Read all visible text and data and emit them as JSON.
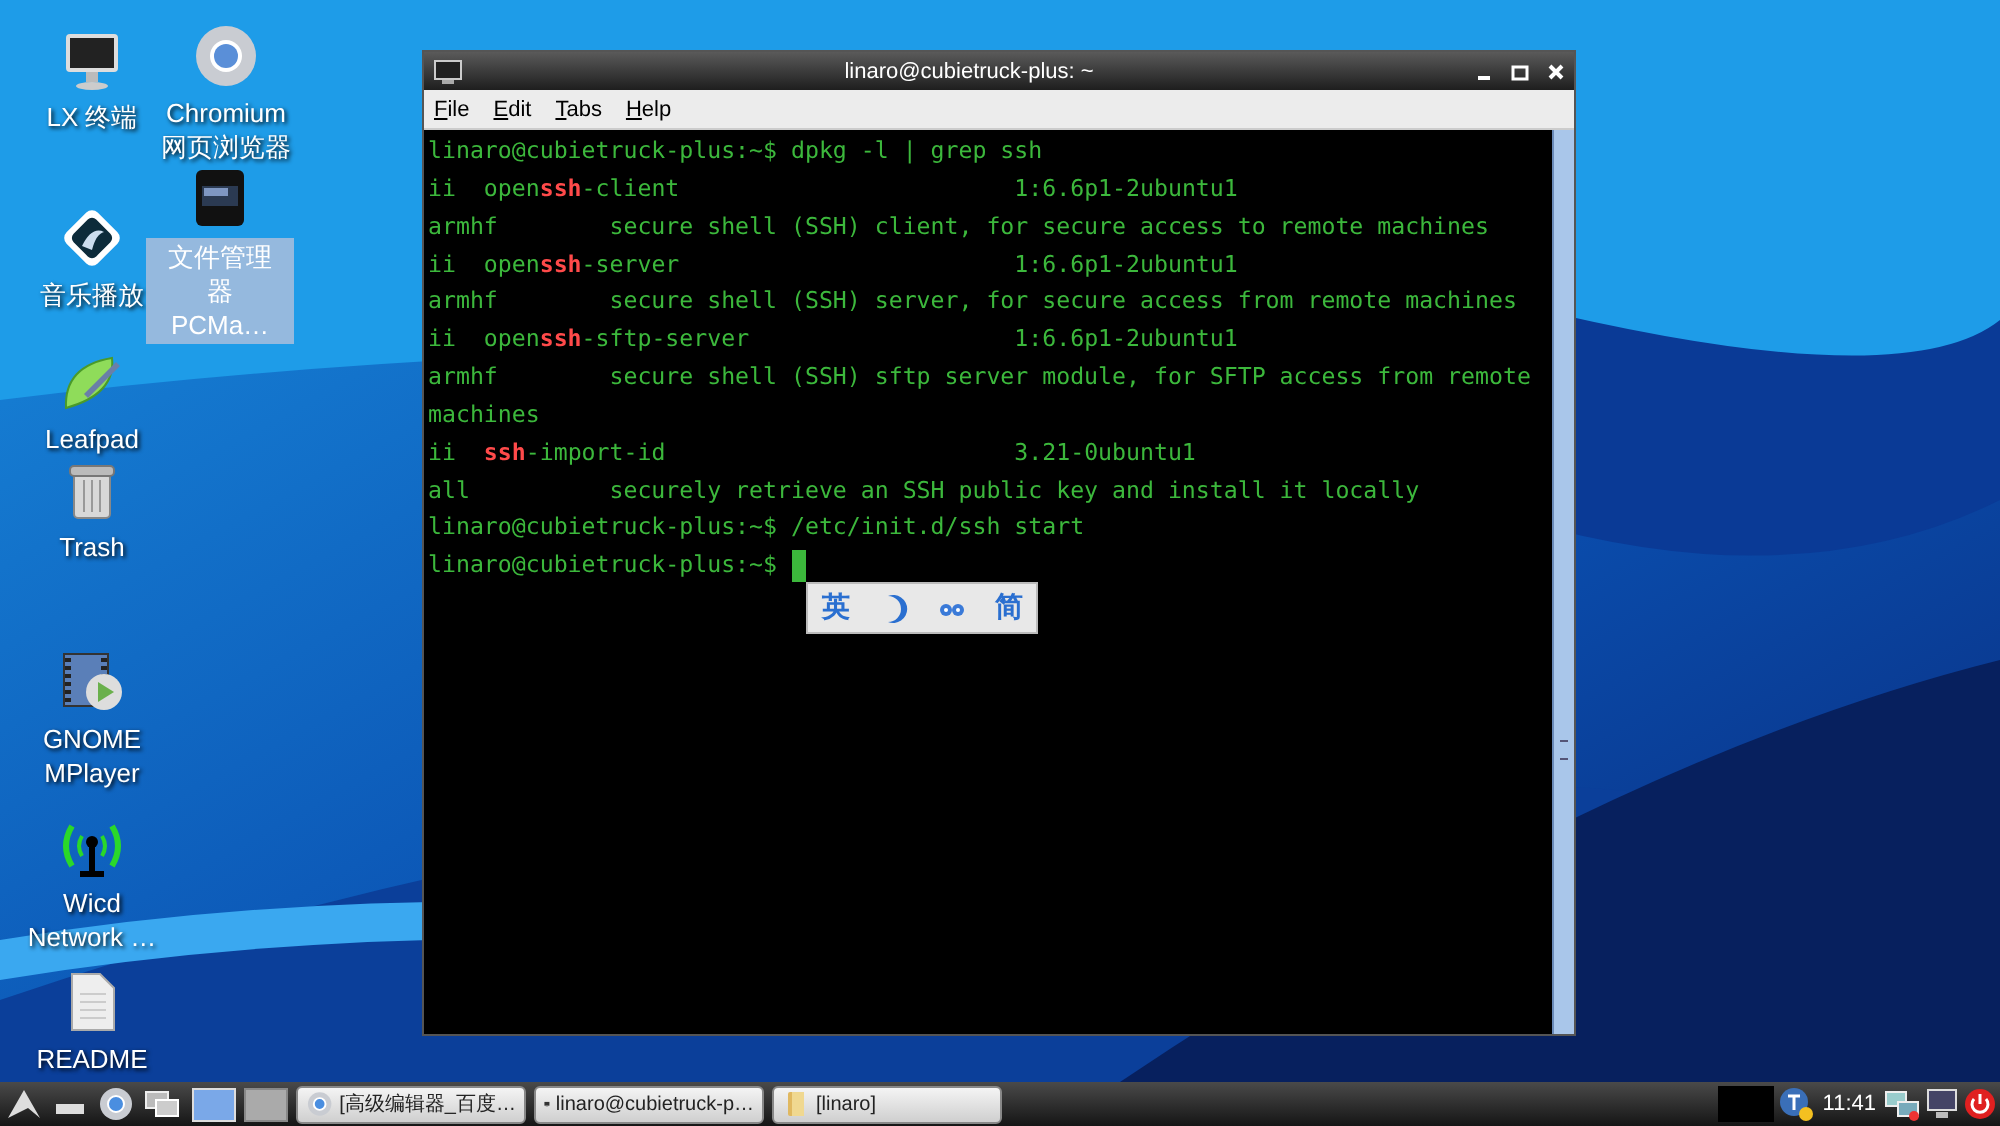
{
  "desktop": {
    "icons": [
      {
        "label": "LX 终端",
        "kind": "monitor",
        "selected": false
      },
      {
        "label": "音乐播放",
        "kind": "music",
        "selected": false
      },
      {
        "label": "Leafpad",
        "kind": "leaf",
        "selected": false
      },
      {
        "label": "Trash",
        "kind": "trash",
        "selected": false
      },
      {
        "label": "GNOME MPlayer",
        "kind": "film",
        "selected": false
      },
      {
        "label": "Wicd Network …",
        "kind": "antenna",
        "selected": false
      },
      {
        "label": "README",
        "kind": "document",
        "selected": false
      },
      {
        "label": "Chromium 网页浏览器",
        "kind": "browser",
        "selected": false
      },
      {
        "label": "文件管理器 PCMa…",
        "kind": "cabinet",
        "selected": true
      }
    ]
  },
  "terminal": {
    "title": "linaro@cubietruck-plus: ~",
    "menu": [
      "File",
      "Edit",
      "Tabs",
      "Help"
    ],
    "cursor": true,
    "lines": [
      {
        "parts": [
          {
            "text": "linaro@cubietruck-plus:~$ dpkg -l | grep ssh",
            "match": false
          }
        ]
      },
      {
        "parts": [
          {
            "text": "ii  open",
            "match": false
          },
          {
            "text": "ssh",
            "match": true
          },
          {
            "text": "-client                        1:6.6p1-2ubuntu1",
            "match": false
          }
        ]
      },
      {
        "parts": [
          {
            "text": "armhf        secure shell (SSH) client, for secure access to remote machines",
            "match": false
          }
        ]
      },
      {
        "parts": [
          {
            "text": "ii  open",
            "match": false
          },
          {
            "text": "ssh",
            "match": true
          },
          {
            "text": "-server                        1:6.6p1-2ubuntu1",
            "match": false
          }
        ]
      },
      {
        "parts": [
          {
            "text": "armhf        secure shell (SSH) server, for secure access from remote machines",
            "match": false
          }
        ]
      },
      {
        "parts": [
          {
            "text": "ii  open",
            "match": false
          },
          {
            "text": "ssh",
            "match": true
          },
          {
            "text": "-sftp-server                   1:6.6p1-2ubuntu1",
            "match": false
          }
        ]
      },
      {
        "parts": [
          {
            "text": "armhf        secure shell (SSH) sftp server module, for SFTP access from remote",
            "match": false
          }
        ]
      },
      {
        "parts": [
          {
            "text": "machines",
            "match": false
          }
        ]
      },
      {
        "parts": [
          {
            "text": "ii  ",
            "match": false
          },
          {
            "text": "ssh",
            "match": true
          },
          {
            "text": "-import-id                         3.21-0ubuntu1",
            "match": false
          }
        ]
      },
      {
        "parts": [
          {
            "text": "all          securely retrieve an SSH public key and install it locally",
            "match": false
          }
        ]
      },
      {
        "parts": [
          {
            "text": "linaro@cubietruck-plus:~$ /etc/init.d/ssh start",
            "match": false
          }
        ]
      },
      {
        "parts": [
          {
            "text": "linaro@cubietruck-plus:~$",
            "match": false
          }
        ]
      }
    ]
  },
  "ime_toolbar": {
    "buttons": [
      {
        "kind": "text",
        "label": "英"
      },
      {
        "kind": "moon"
      },
      {
        "kind": "dots"
      },
      {
        "kind": "text",
        "label": "简"
      }
    ]
  },
  "taskbar": {
    "launchers": [
      {
        "kind": "menu"
      },
      {
        "kind": "desktop"
      },
      {
        "kind": "browser"
      },
      {
        "kind": "windows"
      }
    ],
    "pager": [
      {
        "selected": true
      },
      {
        "selected": false
      }
    ],
    "tasks": [
      {
        "label": "[高级编辑器_百度…",
        "kind": "browser",
        "selected": false
      },
      {
        "label": "linaro@cubietruck-p…",
        "kind": "terminal",
        "selected": false
      },
      {
        "label": "[linaro]",
        "kind": "folder",
        "selected": false
      }
    ],
    "tray": [
      {
        "kind": "applet"
      },
      {
        "kind": "ime"
      },
      {
        "kind": "clock",
        "text": "11:41"
      },
      {
        "kind": "network"
      },
      {
        "kind": "display"
      },
      {
        "kind": "power"
      }
    ]
  }
}
